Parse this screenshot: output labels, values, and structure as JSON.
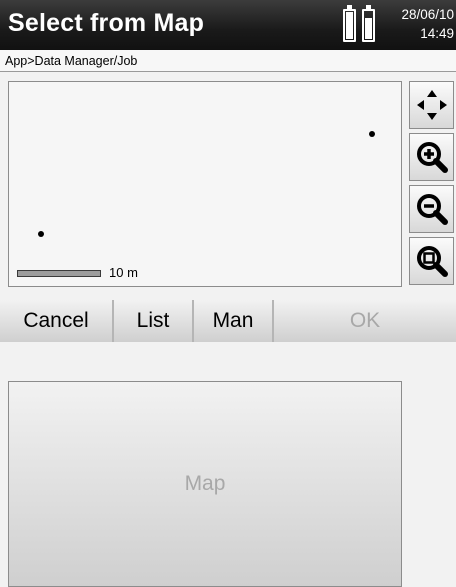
{
  "header": {
    "title": "Select from Map",
    "date": "28/06/10",
    "time": "14:49",
    "battery_icon_1": "battery-icon",
    "battery_icon_2": "battery-icon"
  },
  "breadcrumb": "App>Data Manager/Job",
  "map": {
    "scale_label": "10 m",
    "tools": [
      "pan-icon",
      "zoom-in-icon",
      "zoom-out-icon",
      "zoom-extents-icon"
    ]
  },
  "softkeys": {
    "cancel": "Cancel",
    "map": "Map",
    "list": "List",
    "man": "Man",
    "ok": "OK"
  },
  "colors": {
    "title_bar": "#1a1a1a",
    "disabled_text": "#a8a8a8"
  }
}
